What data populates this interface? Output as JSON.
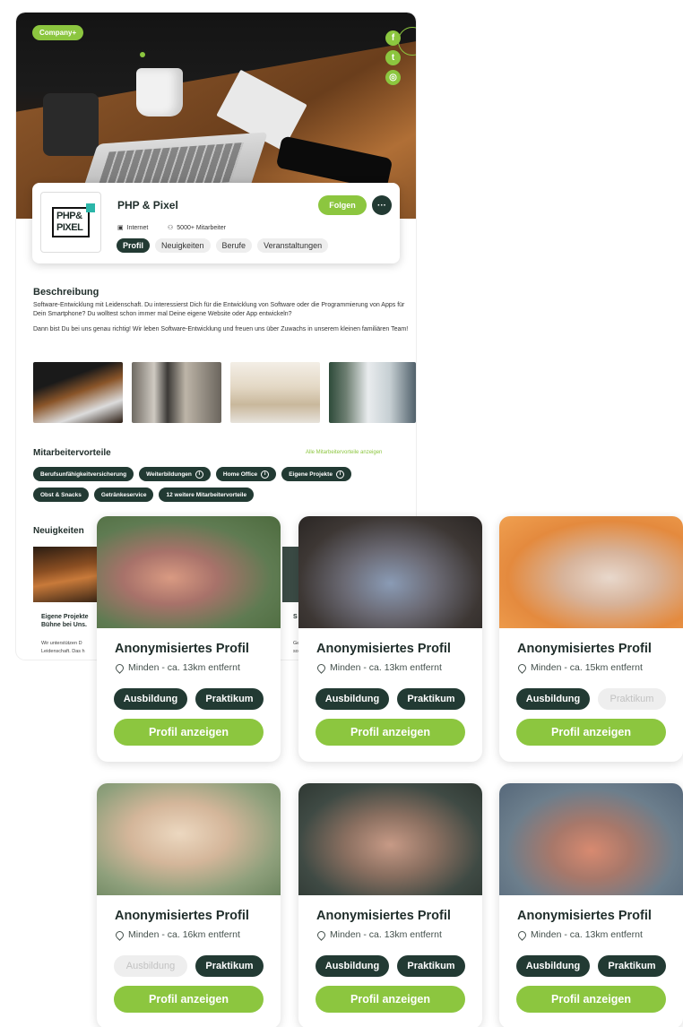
{
  "company": {
    "badge": "Company+",
    "social": [
      {
        "icon": "facebook-icon",
        "glyph": "f"
      },
      {
        "icon": "twitter-icon",
        "glyph": "t"
      },
      {
        "icon": "instagram-icon",
        "glyph": "◎"
      }
    ],
    "logo_text_line1": "PHP&",
    "logo_text_line2": "PIXEL",
    "name": "PHP & Pixel",
    "follow_label": "Folgen",
    "more_label": "···",
    "industry": "Internet",
    "employees": "5000+ Mitarbeiter",
    "tabs": [
      "Profil",
      "Neuigkeiten",
      "Berufe",
      "Veranstaltungen"
    ],
    "active_tab": "Profil"
  },
  "description": {
    "title": "Beschreibung",
    "paragraph1": "Software-Entwicklung mit Leidenschaft. Du interessierst Dich für die Entwicklung von Software oder die Programmierung von Apps für Dein Smartphone? Du wolltest schon immer mal Deine eigene Website oder App entwickeln?",
    "paragraph2": "Dann bist Du bei uns genau richtig! Wir leben Software-Entwicklung und freuen uns über Zuwachs in unserem kleinen familiären Team!"
  },
  "benefits": {
    "title": "Mitarbeitervorteile",
    "link": "Alle Mitarbeitervorteile anzeigen",
    "row1": [
      "Berufsunfähigkeitversicherung",
      "Weiterbildungen",
      "Home Office",
      "Eigene Projekte"
    ],
    "row2": [
      "Obst & Snacks",
      "Getränkeservice",
      "12 weitere Mitarbeitervorteile"
    ]
  },
  "news": {
    "title": "Neuigkeiten",
    "item1_title": "Eigene Projekte Bühne bei Uns.",
    "item1_body": "Wir unterstützen D Leidenschaft. Das h",
    "item2_title": "S e",
    "item2_body": "Ge so"
  },
  "profiles": [
    {
      "title": "Anonymisiertes Profil",
      "location": "Minden - ca. 13km entfernt",
      "ausbildung": "Ausbildung",
      "praktikum": "Praktikum",
      "ausbildung_active": true,
      "praktikum_active": true,
      "cta": "Profil anzeigen"
    },
    {
      "title": "Anonymisiertes Profil",
      "location": "Minden - ca. 13km entfernt",
      "ausbildung": "Ausbildung",
      "praktikum": "Praktikum",
      "ausbildung_active": true,
      "praktikum_active": true,
      "cta": "Profil anzeigen"
    },
    {
      "title": "Anonymisiertes Profil",
      "location": "Minden - ca. 15km entfernt",
      "ausbildung": "Ausbildung",
      "praktikum": "Praktikum",
      "ausbildung_active": true,
      "praktikum_active": false,
      "cta": "Profil anzeigen"
    },
    {
      "title": "Anonymisiertes Profil",
      "location": "Minden - ca. 16km entfernt",
      "ausbildung": "Ausbildung",
      "praktikum": "Praktikum",
      "ausbildung_active": false,
      "praktikum_active": true,
      "cta": "Profil anzeigen"
    },
    {
      "title": "Anonymisiertes Profil",
      "location": "Minden - ca. 13km entfernt",
      "ausbildung": "Ausbildung",
      "praktikum": "Praktikum",
      "ausbildung_active": true,
      "praktikum_active": true,
      "cta": "Profil anzeigen"
    },
    {
      "title": "Anonymisiertes Profil",
      "location": "Minden - ca. 13km entfernt",
      "ausbildung": "Ausbildung",
      "praktikum": "Praktikum",
      "ausbildung_active": true,
      "praktikum_active": true,
      "cta": "Profil anzeigen"
    }
  ],
  "colors": {
    "accent_green": "#8cc63f",
    "dark_green": "#223a33",
    "disabled_pill": "#eeeeee"
  }
}
